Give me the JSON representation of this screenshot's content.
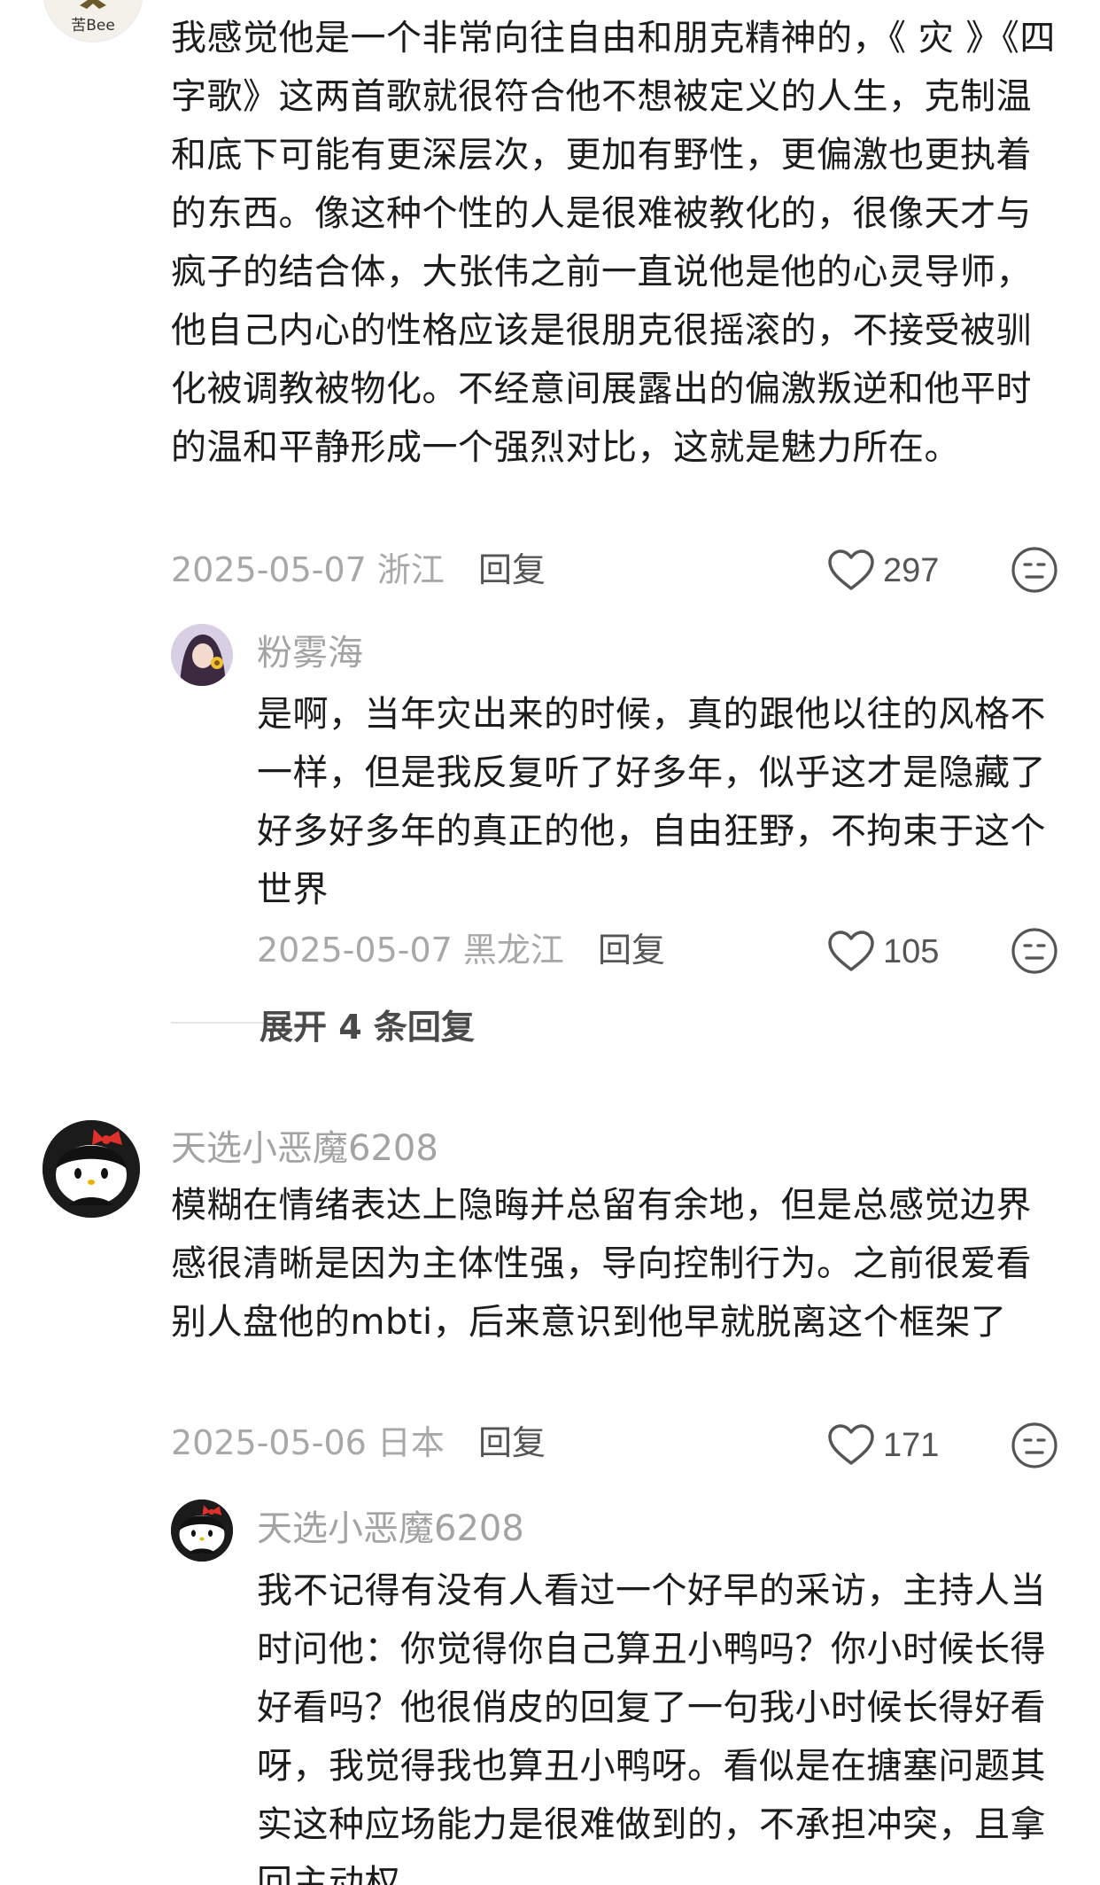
{
  "comments": [
    {
      "avatar_label": "苦Bee",
      "text": "我感觉他是一个非常向往自由和朋克精神的，《 灾 》《四字歌》这两首歌就很符合他不想被定义的人生，克制温和底下可能有更深层次，更加有野性，更偏激也更执着的东西。像这种个性的人是很难被教化的，很像天才与疯子的结合体，大张伟之前一直说他是他的心灵导师，他自己内心的性格应该是很朋克很摇滚的，不接受被驯化被调教被物化。不经意间展露出的偏激叛逆和他平时的温和平静形成一个强烈对比，这就是魅力所在。",
      "date_location": "2025-05-07 浙江",
      "reply_label": "回复",
      "likes": "297"
    },
    {
      "username": "粉雾海",
      "text": "是啊，当年灾出来的时候，真的跟他以往的风格不一样，但是我反复听了好多年，似乎这才是隐藏了好多好多年的真正的他，自由狂野，不拘束于这个世界",
      "date_location": "2025-05-07 黑龙江",
      "reply_label": "回复",
      "likes": "105"
    },
    {
      "username": "天选小恶魔6208",
      "text": "模糊在情绪表达上隐晦并总留有余地，但是总感觉边界感很清晰是因为主体性强，导向控制行为。之前很爱看别人盘他的mbti，后来意识到他早就脱离这个框架了",
      "date_location": "2025-05-06 日本",
      "reply_label": "回复",
      "likes": "171"
    },
    {
      "username": "天选小恶魔6208",
      "text": "我不记得有没有人看过一个好早的采访，主持人当时问他：你觉得你自己算丑小鸭吗？你小时候长得好看吗？他很俏皮的回复了一句我小时候长得好看呀，我觉得我也算丑小鸭呀。看似是在搪塞问题其实这种应场能力是很难做到的，不承担冲突，且拿回主动权"
    }
  ],
  "expand_replies": "展开 4 条回复",
  "icons": {
    "like": "heart-outline-icon",
    "emoji": "emoji-face-icon"
  },
  "colors": {
    "text": "#1c1c1c",
    "meta": "#a8a8a8",
    "action": "#555555"
  }
}
